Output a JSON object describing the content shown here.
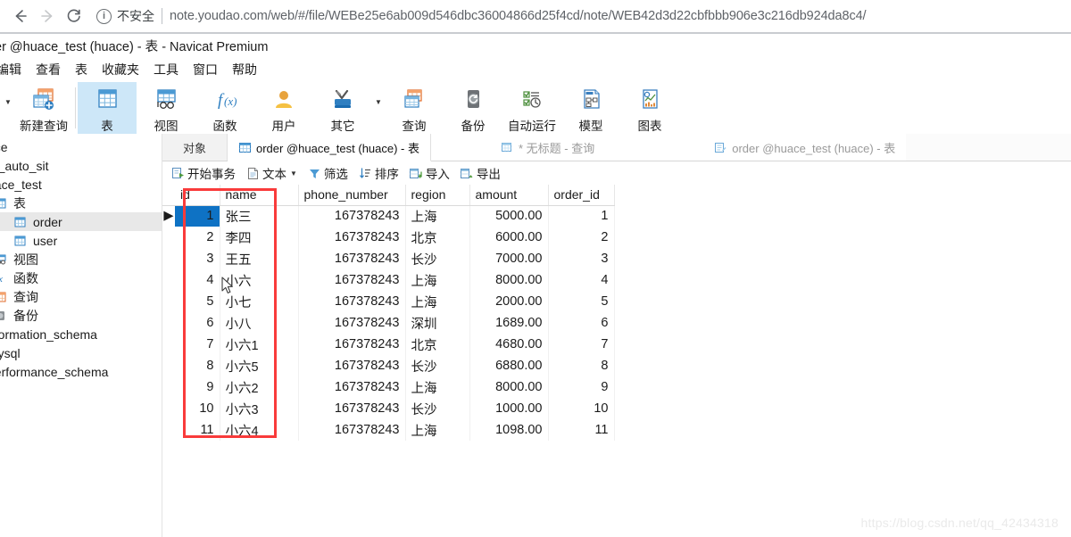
{
  "browser": {
    "back_label": "back-arrow",
    "forward_label": "forward-arrow",
    "reload_label": "reload",
    "security_label": "不安全",
    "url": "note.youdao.com/web/#/file/WEBe25e6ab009d546dbc36004866d25f4cd/note/WEB42d3d22cbfbbb906e3c216db924da8c4/"
  },
  "window": {
    "title": "er @huace_test (huace) - 表 - Navicat Premium"
  },
  "menubar": {
    "items": [
      {
        "label": "编辑"
      },
      {
        "label": "查看"
      },
      {
        "label": "表"
      },
      {
        "label": "收藏夹"
      },
      {
        "label": "工具"
      },
      {
        "label": "窗口"
      },
      {
        "label": "帮助"
      }
    ]
  },
  "toolbar": {
    "items": [
      {
        "label": "新建查询",
        "icon": "new-query-icon",
        "selected": false
      },
      {
        "label": "表",
        "icon": "table-icon",
        "selected": true
      },
      {
        "label": "视图",
        "icon": "view-icon",
        "selected": false
      },
      {
        "label": "函数",
        "icon": "function-icon",
        "selected": false
      },
      {
        "label": "用户",
        "icon": "user-icon",
        "selected": false
      },
      {
        "label": "其它",
        "icon": "other-tools-icon",
        "selected": false
      },
      {
        "label": "查询",
        "icon": "query-icon",
        "selected": false
      },
      {
        "label": "备份",
        "icon": "backup-icon",
        "selected": false
      },
      {
        "label": "自动运行",
        "icon": "automation-icon",
        "selected": false
      },
      {
        "label": "模型",
        "icon": "model-icon",
        "selected": false
      },
      {
        "label": "图表",
        "icon": "chart-icon",
        "selected": false
      }
    ]
  },
  "sidebar": {
    "items": [
      {
        "label": "ace",
        "icon": "",
        "indent": 0,
        "selected": false
      },
      {
        "label": "tp_auto_sit",
        "icon": "",
        "indent": 0,
        "selected": false
      },
      {
        "label": "uace_test",
        "icon": "",
        "indent": 0,
        "selected": false
      },
      {
        "label": "表",
        "icon": "folder-table-icon",
        "indent": 1,
        "selected": false
      },
      {
        "label": "order",
        "icon": "table-icon",
        "indent": 2,
        "selected": true
      },
      {
        "label": "user",
        "icon": "table-icon",
        "indent": 2,
        "selected": false
      },
      {
        "label": "视图",
        "icon": "folder-view-icon",
        "indent": 1,
        "selected": false
      },
      {
        "label": "函数",
        "icon": "folder-function-icon",
        "indent": 1,
        "selected": false
      },
      {
        "label": "查询",
        "icon": "folder-query-icon",
        "indent": 1,
        "selected": false
      },
      {
        "label": "备份",
        "icon": "folder-backup-icon",
        "indent": 1,
        "selected": false
      },
      {
        "label": "nformation_schema",
        "icon": "",
        "indent": 0,
        "selected": false
      },
      {
        "label": "mysql",
        "icon": "",
        "indent": 0,
        "selected": false
      },
      {
        "label": "performance_schema",
        "icon": "",
        "indent": 0,
        "selected": false
      }
    ]
  },
  "tabs": {
    "object_label": "对象",
    "items": [
      {
        "label": "order @huace_test (huace) - 表",
        "icon": "table-tab-icon",
        "active": true
      },
      {
        "label": "* 无标题 - 查询",
        "icon": "query-tab-icon",
        "active": false
      },
      {
        "label": "order @huace_test (huace) - 表",
        "icon": "table-design-tab-icon",
        "active": false
      }
    ]
  },
  "subtoolbar": {
    "items": [
      {
        "label": "开始事务",
        "icon": "transaction-icon",
        "caret": false
      },
      {
        "label": "文本",
        "icon": "text-icon",
        "caret": true
      },
      {
        "label": "筛选",
        "icon": "filter-icon",
        "caret": false
      },
      {
        "label": "排序",
        "icon": "sort-icon",
        "caret": false
      },
      {
        "label": "导入",
        "icon": "import-icon",
        "caret": false
      },
      {
        "label": "导出",
        "icon": "export-icon",
        "caret": false
      }
    ]
  },
  "grid": {
    "columns": [
      "id",
      "name",
      "phone_number",
      "region",
      "amount",
      "order_id"
    ],
    "rows": [
      {
        "id": "1",
        "name": "张三",
        "phone_number": "167378243",
        "region": "上海",
        "amount": "5000.00",
        "order_id": "1",
        "selected": true
      },
      {
        "id": "2",
        "name": "李四",
        "phone_number": "167378243",
        "region": "北京",
        "amount": "6000.00",
        "order_id": "2",
        "selected": false
      },
      {
        "id": "3",
        "name": "王五",
        "phone_number": "167378243",
        "region": "长沙",
        "amount": "7000.00",
        "order_id": "3",
        "selected": false
      },
      {
        "id": "4",
        "name": "小六",
        "phone_number": "167378243",
        "region": "上海",
        "amount": "8000.00",
        "order_id": "4",
        "selected": false
      },
      {
        "id": "5",
        "name": "小七",
        "phone_number": "167378243",
        "region": "上海",
        "amount": "2000.00",
        "order_id": "5",
        "selected": false
      },
      {
        "id": "6",
        "name": "小八",
        "phone_number": "167378243",
        "region": "深圳",
        "amount": "1689.00",
        "order_id": "6",
        "selected": false
      },
      {
        "id": "7",
        "name": "小六1",
        "phone_number": "167378243",
        "region": "北京",
        "amount": "4680.00",
        "order_id": "7",
        "selected": false
      },
      {
        "id": "8",
        "name": "小六5",
        "phone_number": "167378243",
        "region": "长沙",
        "amount": "6880.00",
        "order_id": "8",
        "selected": false
      },
      {
        "id": "9",
        "name": "小六2",
        "phone_number": "167378243",
        "region": "上海",
        "amount": "8000.00",
        "order_id": "9",
        "selected": false
      },
      {
        "id": "10",
        "name": "小六3",
        "phone_number": "167378243",
        "region": "长沙",
        "amount": "1000.00",
        "order_id": "10",
        "selected": false
      },
      {
        "id": "11",
        "name": "小六4",
        "phone_number": "167378243",
        "region": "上海",
        "amount": "1098.00",
        "order_id": "11",
        "selected": false
      }
    ]
  },
  "annotation": {
    "color": "#f93b3b",
    "name": "name-column-highlight"
  },
  "watermark": {
    "text": "https://blog.csdn.net/qq_42434318"
  }
}
